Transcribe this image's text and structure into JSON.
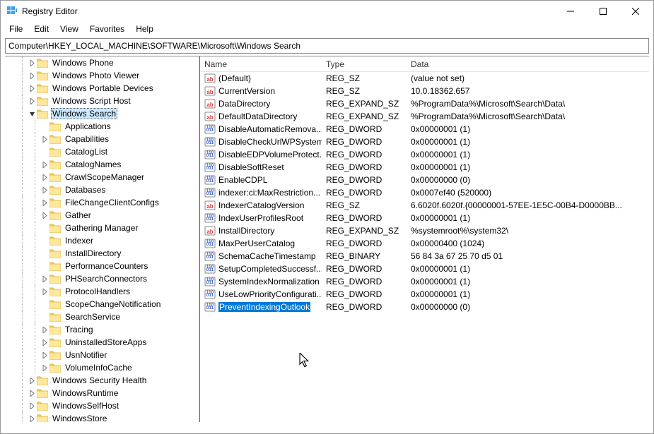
{
  "titlebar": {
    "title": "Registry Editor"
  },
  "menu": {
    "file": "File",
    "edit": "Edit",
    "view": "View",
    "favorites": "Favorites",
    "help": "Help"
  },
  "address": "Computer\\HKEY_LOCAL_MACHINE\\SOFTWARE\\Microsoft\\Windows Search",
  "tree": [
    {
      "label": "Windows Phone",
      "depth": 5,
      "exp": "closed"
    },
    {
      "label": "Windows Photo Viewer",
      "depth": 5,
      "exp": "closed"
    },
    {
      "label": "Windows Portable Devices",
      "depth": 5,
      "exp": "closed"
    },
    {
      "label": "Windows Script Host",
      "depth": 5,
      "exp": "closed"
    },
    {
      "label": "Windows Search",
      "depth": 5,
      "exp": "open",
      "selected": true
    },
    {
      "label": "Applications",
      "depth": 6,
      "exp": "none"
    },
    {
      "label": "Capabilities",
      "depth": 6,
      "exp": "closed"
    },
    {
      "label": "CatalogList",
      "depth": 6,
      "exp": "none"
    },
    {
      "label": "CatalogNames",
      "depth": 6,
      "exp": "closed"
    },
    {
      "label": "CrawlScopeManager",
      "depth": 6,
      "exp": "closed"
    },
    {
      "label": "Databases",
      "depth": 6,
      "exp": "closed"
    },
    {
      "label": "FileChangeClientConfigs",
      "depth": 6,
      "exp": "closed"
    },
    {
      "label": "Gather",
      "depth": 6,
      "exp": "closed"
    },
    {
      "label": "Gathering Manager",
      "depth": 6,
      "exp": "none"
    },
    {
      "label": "Indexer",
      "depth": 6,
      "exp": "none"
    },
    {
      "label": "InstallDirectory",
      "depth": 6,
      "exp": "none"
    },
    {
      "label": "PerformanceCounters",
      "depth": 6,
      "exp": "none"
    },
    {
      "label": "PHSearchConnectors",
      "depth": 6,
      "exp": "closed"
    },
    {
      "label": "ProtocolHandlers",
      "depth": 6,
      "exp": "closed"
    },
    {
      "label": "ScopeChangeNotification",
      "depth": 6,
      "exp": "none"
    },
    {
      "label": "SearchService",
      "depth": 6,
      "exp": "none"
    },
    {
      "label": "Tracing",
      "depth": 6,
      "exp": "closed"
    },
    {
      "label": "UninstalledStoreApps",
      "depth": 6,
      "exp": "closed"
    },
    {
      "label": "UsnNotifier",
      "depth": 6,
      "exp": "closed"
    },
    {
      "label": "VolumeInfoCache",
      "depth": 6,
      "exp": "closed"
    },
    {
      "label": "Windows Security Health",
      "depth": 5,
      "exp": "closed"
    },
    {
      "label": "WindowsRuntime",
      "depth": 5,
      "exp": "closed"
    },
    {
      "label": "WindowsSelfHost",
      "depth": 5,
      "exp": "closed"
    },
    {
      "label": "WindowsStore",
      "depth": 5,
      "exp": "closed"
    }
  ],
  "columns": {
    "name": "Name",
    "type": "Type",
    "data": "Data"
  },
  "values": [
    {
      "icon": "str",
      "name": "(Default)",
      "type": "REG_SZ",
      "data": "(value not set)"
    },
    {
      "icon": "str",
      "name": "CurrentVersion",
      "type": "REG_SZ",
      "data": "10.0.18362.657"
    },
    {
      "icon": "str",
      "name": "DataDirectory",
      "type": "REG_EXPAND_SZ",
      "data": "%ProgramData%\\Microsoft\\Search\\Data\\"
    },
    {
      "icon": "str",
      "name": "DefaultDataDirectory",
      "type": "REG_EXPAND_SZ",
      "data": "%ProgramData%\\Microsoft\\Search\\Data\\"
    },
    {
      "icon": "bin",
      "name": "DisableAutomaticRemova...",
      "type": "REG_DWORD",
      "data": "0x00000001 (1)"
    },
    {
      "icon": "bin",
      "name": "DisableCheckUrlWPSystem",
      "type": "REG_DWORD",
      "data": "0x00000001 (1)"
    },
    {
      "icon": "bin",
      "name": "DisableEDPVolumeProtect...",
      "type": "REG_DWORD",
      "data": "0x00000001 (1)"
    },
    {
      "icon": "bin",
      "name": "DisableSoftReset",
      "type": "REG_DWORD",
      "data": "0x00000001 (1)"
    },
    {
      "icon": "bin",
      "name": "EnableCDPL",
      "type": "REG_DWORD",
      "data": "0x00000000 (0)"
    },
    {
      "icon": "bin",
      "name": "indexer:ci:MaxRestriction...",
      "type": "REG_DWORD",
      "data": "0x0007ef40 (520000)"
    },
    {
      "icon": "str",
      "name": "IndexerCatalogVersion",
      "type": "REG_SZ",
      "data": "6.6020f.6020f.{00000001-57EE-1E5C-00B4-D0000BB..."
    },
    {
      "icon": "bin",
      "name": "IndexUserProfilesRoot",
      "type": "REG_DWORD",
      "data": "0x00000001 (1)"
    },
    {
      "icon": "str",
      "name": "InstallDirectory",
      "type": "REG_EXPAND_SZ",
      "data": "%systemroot%\\system32\\"
    },
    {
      "icon": "bin",
      "name": "MaxPerUserCatalog",
      "type": "REG_DWORD",
      "data": "0x00000400 (1024)"
    },
    {
      "icon": "bin",
      "name": "SchemaCacheTimestamp",
      "type": "REG_BINARY",
      "data": "56 84 3a 67 25 70 d5 01"
    },
    {
      "icon": "bin",
      "name": "SetupCompletedSuccessf...",
      "type": "REG_DWORD",
      "data": "0x00000001 (1)"
    },
    {
      "icon": "bin",
      "name": "SystemIndexNormalization",
      "type": "REG_DWORD",
      "data": "0x00000001 (1)"
    },
    {
      "icon": "bin",
      "name": "UseLowPriorityConfigurati...",
      "type": "REG_DWORD",
      "data": "0x00000001 (1)"
    },
    {
      "icon": "bin",
      "name": "PreventIndexingOutlook",
      "type": "REG_DWORD",
      "data": "0x00000000 (0)",
      "selected": true
    }
  ]
}
